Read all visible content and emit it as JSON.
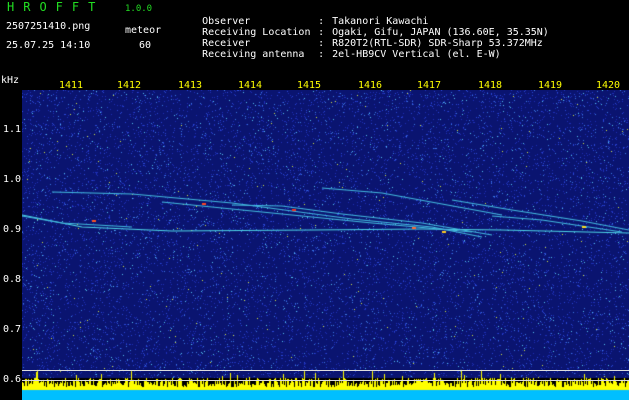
{
  "app": {
    "title": "HROFFT",
    "version": "1.0.0",
    "file_name": "2507251410.png",
    "timestamp": "25.07.25 14:10",
    "mode_label": "meteor",
    "mode_count": "60"
  },
  "info": [
    {
      "key": "Observer",
      "value": "Takanori Kawachi"
    },
    {
      "key": "Receiving Location",
      "value": "Ogaki, Gifu, JAPAN (136.60E, 35.35N)"
    },
    {
      "key": "Receiver",
      "value": "R820T2(RTL-SDR) SDR-Sharp 53.372MHz"
    },
    {
      "key": "Receiving antenna",
      "value": "2el-HB9CV Vertical (el. E-W)"
    }
  ],
  "info_separator": ":",
  "y_axis": {
    "unit": "kHz",
    "ticks": [
      "1.1",
      "1.0",
      "0.9",
      "0.8",
      "0.7",
      "0.6"
    ]
  },
  "x_axis": {
    "ticks": [
      "1411",
      "1412",
      "1413",
      "1414",
      "1415",
      "1416",
      "1417",
      "1418",
      "1419",
      "1420"
    ]
  },
  "colors": {
    "background": "#000000",
    "header_accent": "#22dd22",
    "x_tick_color": "#ffff00",
    "noise_blue": "#1a2aa8",
    "signal_cyan": "#33ccee",
    "bottom_band": "#00bfff",
    "bottom_spikes": "#ffff00"
  }
}
